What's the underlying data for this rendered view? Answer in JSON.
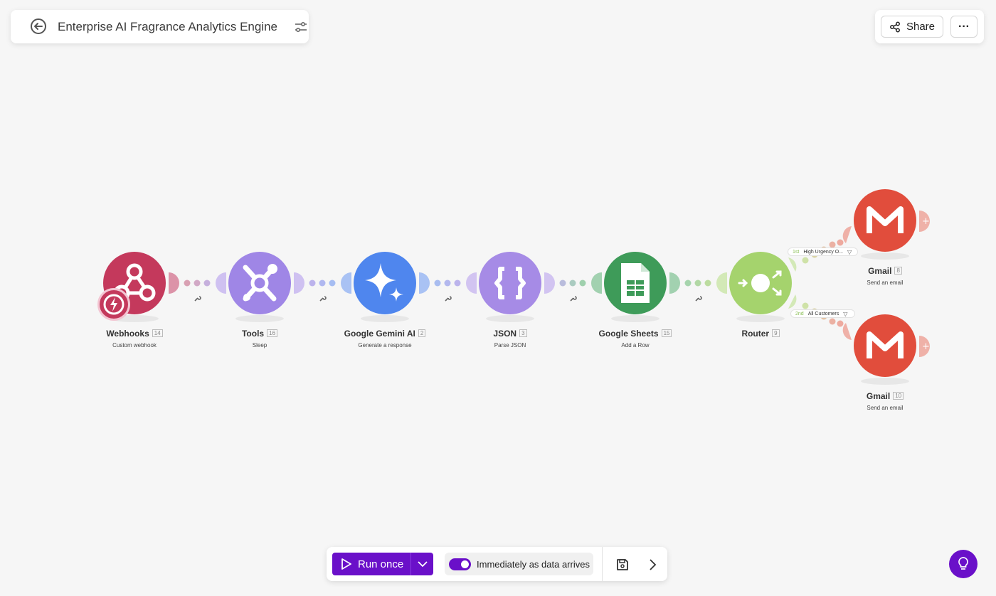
{
  "header": {
    "title": "Enterprise AI Fragrance Analytics Engine"
  },
  "actions": {
    "share_label": "Share",
    "more_label": "···"
  },
  "modules": [
    {
      "name": "Webhooks",
      "id": "14",
      "action": "Custom webhook",
      "color": "#c4395c",
      "icon": "webhook-icon"
    },
    {
      "name": "Tools",
      "id": "16",
      "action": "Sleep",
      "color": "#9f86e6",
      "icon": "tools-icon"
    },
    {
      "name": "Google Gemini AI",
      "id": "2",
      "action": "Generate a response",
      "color": "#4f86ee",
      "icon": "gemini-sparkle-icon"
    },
    {
      "name": "JSON",
      "id": "3",
      "action": "Parse JSON",
      "color": "#a68be6",
      "icon": "braces-icon"
    },
    {
      "name": "Google Sheets",
      "id": "15",
      "action": "Add a Row",
      "color": "#3e9b59",
      "icon": "sheets-icon"
    },
    {
      "name": "Router",
      "id": "9",
      "action": "",
      "color": "#a5d36d",
      "icon": "router-icon"
    },
    {
      "name": "Gmail",
      "id": "8",
      "action": "Send an email",
      "color": "#e14d3c",
      "icon": "gmail-icon"
    },
    {
      "name": "Gmail",
      "id": "10",
      "action": "Send an email",
      "color": "#e14d3c",
      "icon": "gmail-icon"
    }
  ],
  "routes": [
    {
      "order": "1st",
      "label": "High Urgency O..."
    },
    {
      "order": "2nd",
      "label": "All Customers"
    }
  ],
  "toolbar": {
    "run_label": "Run once",
    "schedule_label": "Immediately as data arrives",
    "schedule_enabled": true
  }
}
